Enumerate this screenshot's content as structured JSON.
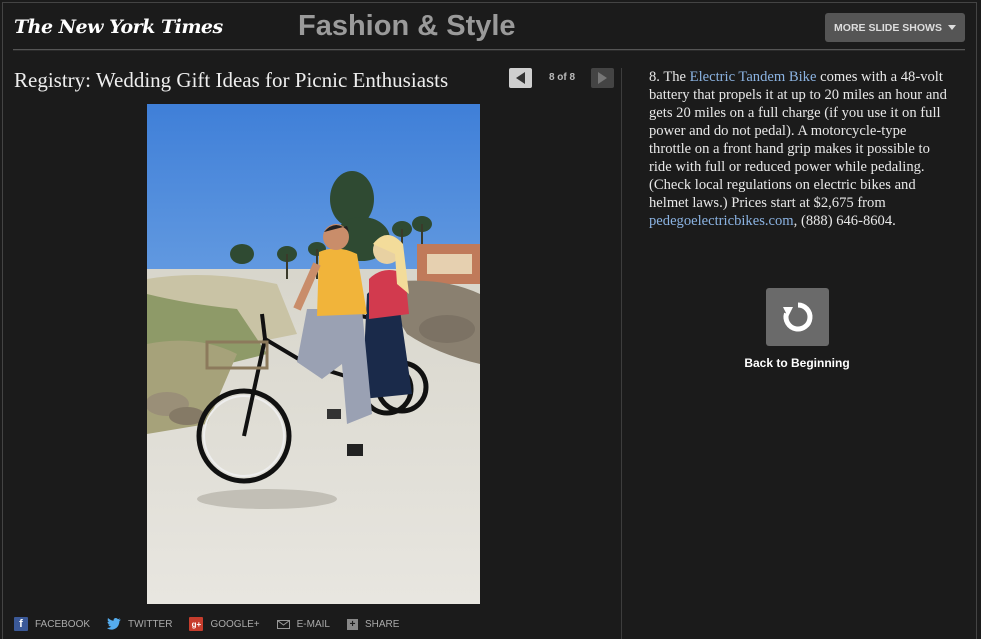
{
  "header": {
    "logo": "The New York Times",
    "section": "Fashion & Style",
    "more_button": "MORE SLIDE SHOWS"
  },
  "slideshow": {
    "title": "Registry: Wedding Gift Ideas for Picnic Enthusiasts",
    "counter": "8 of 8"
  },
  "caption": {
    "part1": "8. The ",
    "link1": "Electric Tandem Bike",
    "part2": " comes with a 48-volt battery that propels it at up to 20 miles an hour and gets 20 miles on a full charge (if you use it on full power and do not pedal). A motorcycle-type throttle on a front hand grip makes it possible to ride with full or reduced power while pedaling. (Check local regulations on electric bikes and helmet laws.) Prices start at $2,675 from ",
    "link2": "pedegoelectricbikes.com",
    "part3": ", (888) 646-8604."
  },
  "back": {
    "label": "Back to Beginning"
  },
  "share": {
    "facebook": "FACEBOOK",
    "twitter": "TWITTER",
    "google": "GOOGLE+",
    "email": "E-MAIL",
    "share": "SHARE"
  },
  "colors": {
    "background": "#1b1b1b",
    "link": "#8bb3e2",
    "section_title": "#9a9a9a"
  },
  "icons": [
    "chevron-down-icon",
    "prev-arrow-icon",
    "next-arrow-icon",
    "replay-icon",
    "facebook-icon",
    "twitter-icon",
    "google-plus-icon",
    "email-icon",
    "share-icon"
  ]
}
